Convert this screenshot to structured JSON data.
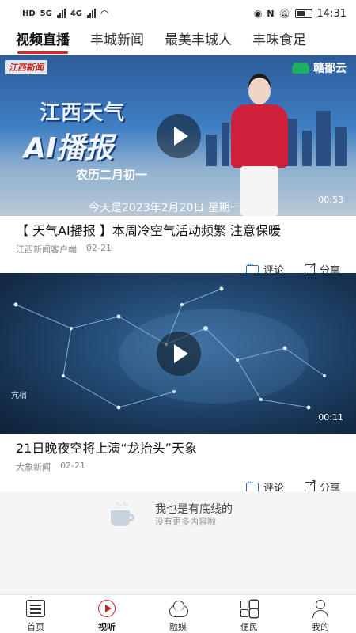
{
  "status_bar": {
    "left_tags": [
      "HD",
      "HD"
    ],
    "network": [
      "5G",
      "4G"
    ],
    "time": "14:31"
  },
  "top_tabs": [
    {
      "label": "视频直播",
      "active": true
    },
    {
      "label": "丰城新闻",
      "active": false
    },
    {
      "label": "最美丰城人",
      "active": false
    },
    {
      "label": "丰味食足",
      "active": false
    }
  ],
  "videos": [
    {
      "thumbnail": {
        "logo_left": "江西新闻",
        "logo_right": "赣鄱云",
        "headline": "江西天气",
        "headline_big": "AI播报",
        "lunar": "农历二月初一",
        "date_line": "今天是2023年2月20日 星期一"
      },
      "duration": "00:53",
      "title": "【 天气AI播报 】本周冷空气活动频繁 注意保暖",
      "source": "江西新闻客户端",
      "date": "02-21",
      "comment_label": "评论",
      "share_label": "分享"
    },
    {
      "thumbnail": {
        "label": "亢宿"
      },
      "duration": "00:11",
      "title": "21日晚夜空将上演“龙抬头”天象",
      "source": "大象新闻",
      "date": "02-21",
      "comment_label": "评论",
      "share_label": "分享"
    }
  ],
  "end_message": {
    "title": "我也是有底线的",
    "subtitle": "没有更多内容啦"
  },
  "tabbar": [
    {
      "label": "首页",
      "icon": "home-list-icon",
      "active": false
    },
    {
      "label": "视听",
      "icon": "play-circle-icon",
      "active": true
    },
    {
      "label": "融媒",
      "icon": "cloud-icon",
      "active": false
    },
    {
      "label": "便民",
      "icon": "grid-icon",
      "active": false
    },
    {
      "label": "我的",
      "icon": "user-icon",
      "active": false
    }
  ],
  "colors": {
    "accent": "#d9261c",
    "comment_icon": "#2f6fb3"
  }
}
